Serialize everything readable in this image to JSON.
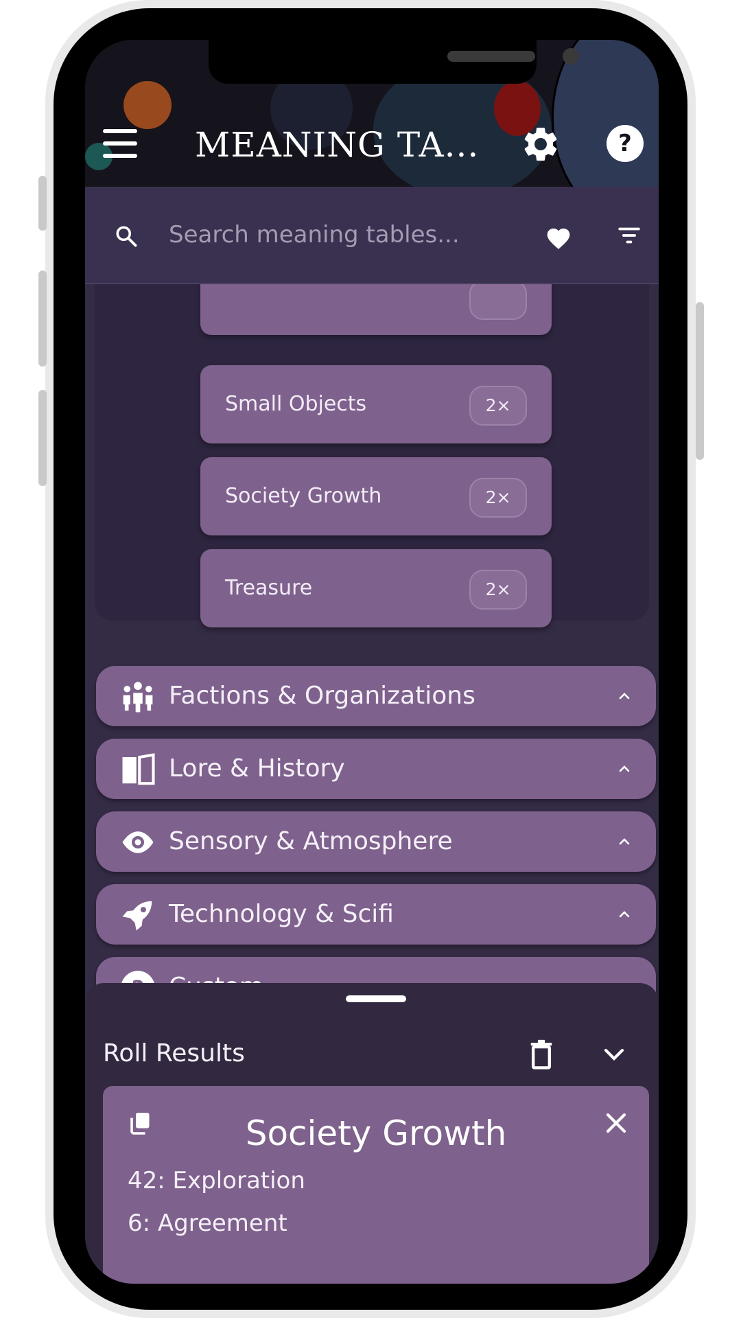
{
  "header": {
    "title": "MEANING TA..."
  },
  "search": {
    "placeholder": "Search meaning tables..."
  },
  "tables": [
    {
      "label": "Small Objects",
      "badge": "2×"
    },
    {
      "label": "Society Growth",
      "badge": "2×"
    },
    {
      "label": "Treasure",
      "badge": "2×"
    }
  ],
  "categories": [
    {
      "label": "Factions & Organizations",
      "icon": "people-icon"
    },
    {
      "label": "Lore & History",
      "icon": "book-icon"
    },
    {
      "label": "Sensory & Atmosphere",
      "icon": "eye-icon"
    },
    {
      "label": "Technology & Scifi",
      "icon": "rocket-icon"
    },
    {
      "label": "Custom",
      "icon": "question-icon"
    }
  ],
  "results": {
    "title": "Roll Results",
    "card": {
      "title": "Society Growth",
      "lines": [
        "42: Exploration",
        "6: Agreement"
      ]
    }
  },
  "colors": {
    "background": "#342b45",
    "card": "#7e618c",
    "header": "#15131b",
    "sheet": "#322941"
  }
}
